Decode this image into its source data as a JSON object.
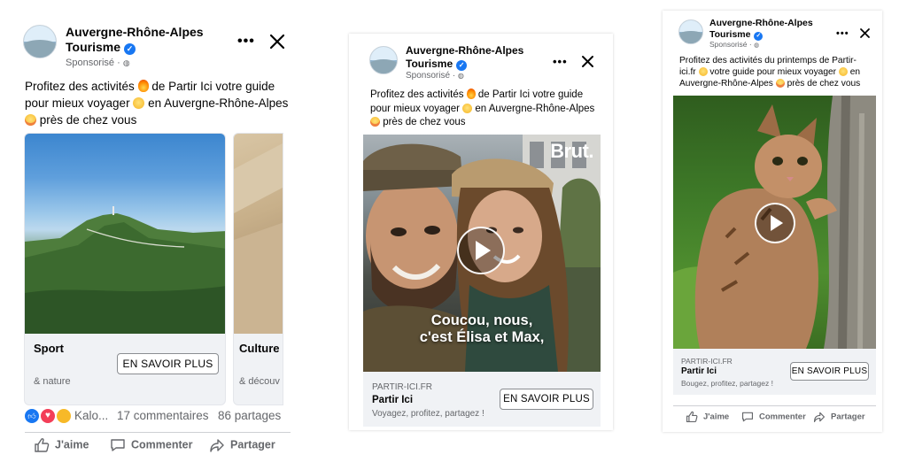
{
  "page": {
    "brand_blue": "#1877f2",
    "reaction_red": "#f33e58"
  },
  "post1": {
    "page_name": "Auvergne-Rhône-Alpes Tourisme",
    "sponsored": "Sponsorisé · ",
    "text_a": "Profitez des activités ",
    "text_b": " de Partir Ici votre guide pour mieux voyager ",
    "text_c": " en Auvergne-Rhône-Alpes ",
    "text_d": " près de chez vous",
    "carousel": [
      {
        "title": "Sport",
        "subtitle": "& nature",
        "cta": "EN SAVOIR PLUS"
      },
      {
        "title": "Culture",
        "subtitle": "& découv"
      }
    ],
    "reactions_name": "Kalo...",
    "comments": "17 commentaires",
    "shares": "86 partages",
    "actions": [
      "J'aime",
      "Commenter",
      "Partager"
    ]
  },
  "post2": {
    "page_name": "Auvergne-Rhône-Alpes Tourisme",
    "sponsored": "Sponsorisé · ",
    "text_a": "Profitez des activités ",
    "text_b": " de Partir Ici votre guide pour mieux voyager ",
    "text_c": " en Auvergne-Rhône-Alpes ",
    "text_d": " près de chez vous",
    "video_brand": "Brut.",
    "subtitle_line1": "Coucou, nous,",
    "subtitle_line2": "c'est Élisa et Max,",
    "domain": "PARTIR-ICI.FR",
    "ad_title": "Partir Ici",
    "ad_sub": "Voyagez, profitez, partagez !",
    "cta": "EN SAVOIR PLUS"
  },
  "post3": {
    "page_name": "Auvergne-Rhône-Alpes Tourisme",
    "sponsored": "Sponsorisé · ",
    "text_a": "Profitez des activités du printemps de Partir-ici.fr ",
    "text_b": " votre guide pour mieux voyager ",
    "text_c": " en Auvergne-Rhône-Alpes ",
    "text_d": " près de chez vous",
    "domain": "PARTIR-ICI.FR",
    "ad_title": "Partir Ici",
    "ad_sub": "Bougez, profitez, partagez !",
    "cta": "EN SAVOIR PLUS",
    "actions": [
      "J'aime",
      "Commenter",
      "Partager"
    ]
  }
}
